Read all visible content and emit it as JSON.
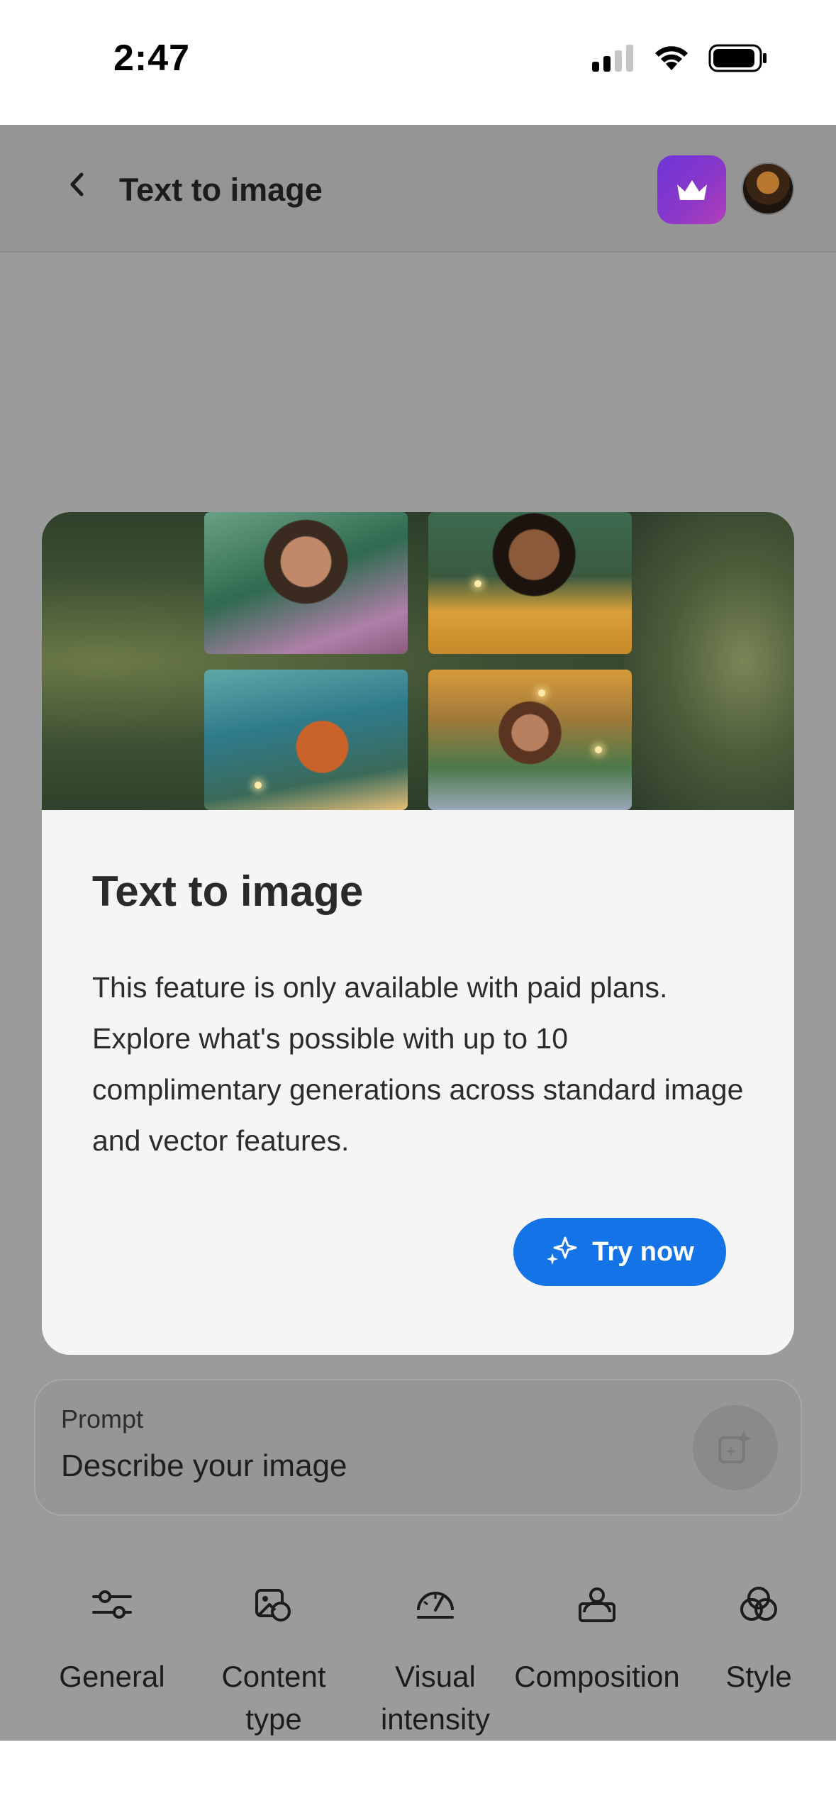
{
  "status_bar": {
    "time": "2:47"
  },
  "header": {
    "title": "Text to image",
    "back_icon": "chevron-left-icon",
    "premium_icon": "crown-icon"
  },
  "modal": {
    "title": "Text to image",
    "body": "This feature is only available with paid plans. Explore what's possible with up to 10 complimentary generations across standard image and vector features.",
    "cta_label": "Try now",
    "cta_color": "#1473e6"
  },
  "prompt": {
    "label": "Prompt",
    "placeholder": "Describe your image"
  },
  "toolbar": {
    "items": [
      {
        "label": "General",
        "icon": "sliders-icon"
      },
      {
        "label": "Content\ntype",
        "icon": "content-type-icon"
      },
      {
        "label": "Visual\nintensity",
        "icon": "gauge-icon"
      },
      {
        "label": "Composition",
        "icon": "composition-icon"
      },
      {
        "label": "Style",
        "icon": "style-circles-icon"
      }
    ]
  }
}
